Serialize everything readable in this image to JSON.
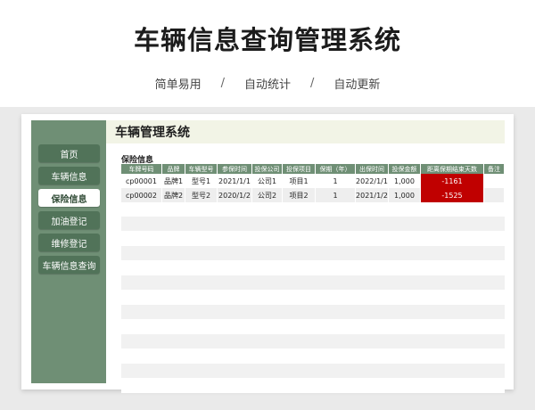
{
  "banner": {
    "title": "车辆信息查询管理系统",
    "features": [
      "简单易用",
      "自动统计",
      "自动更新"
    ],
    "separator": "/"
  },
  "sidebar": {
    "items": [
      {
        "label": "首页",
        "active": false
      },
      {
        "label": "车辆信息",
        "active": false
      },
      {
        "label": "保险信息",
        "active": true
      },
      {
        "label": "加油登记",
        "active": false
      },
      {
        "label": "维修登记",
        "active": false
      },
      {
        "label": "车辆信息查询",
        "active": false
      }
    ]
  },
  "header": {
    "title": "车辆管理系统"
  },
  "section": {
    "title": "保险信息"
  },
  "table": {
    "columns": [
      "车牌号码",
      "品牌",
      "车辆型号",
      "参保时间",
      "投保公司",
      "投保项目",
      "保期（年）",
      "出保时间",
      "投保金额",
      "距离保期结束天数",
      "备注"
    ],
    "rows": [
      [
        "cp00001",
        "品牌1",
        "型号1",
        "2021/1/1",
        "公司1",
        "项目1",
        "1",
        "2022/1/1",
        "1,000",
        "-1161",
        ""
      ],
      [
        "cp00002",
        "品牌2",
        "型号2",
        "2020/1/2",
        "公司2",
        "项目2",
        "1",
        "2021/1/2",
        "1,000",
        "-1525",
        ""
      ]
    ]
  },
  "colors": {
    "sidebar": "#6f8f75",
    "alert": "#c00000",
    "header_bg": "#f2f4e6"
  }
}
